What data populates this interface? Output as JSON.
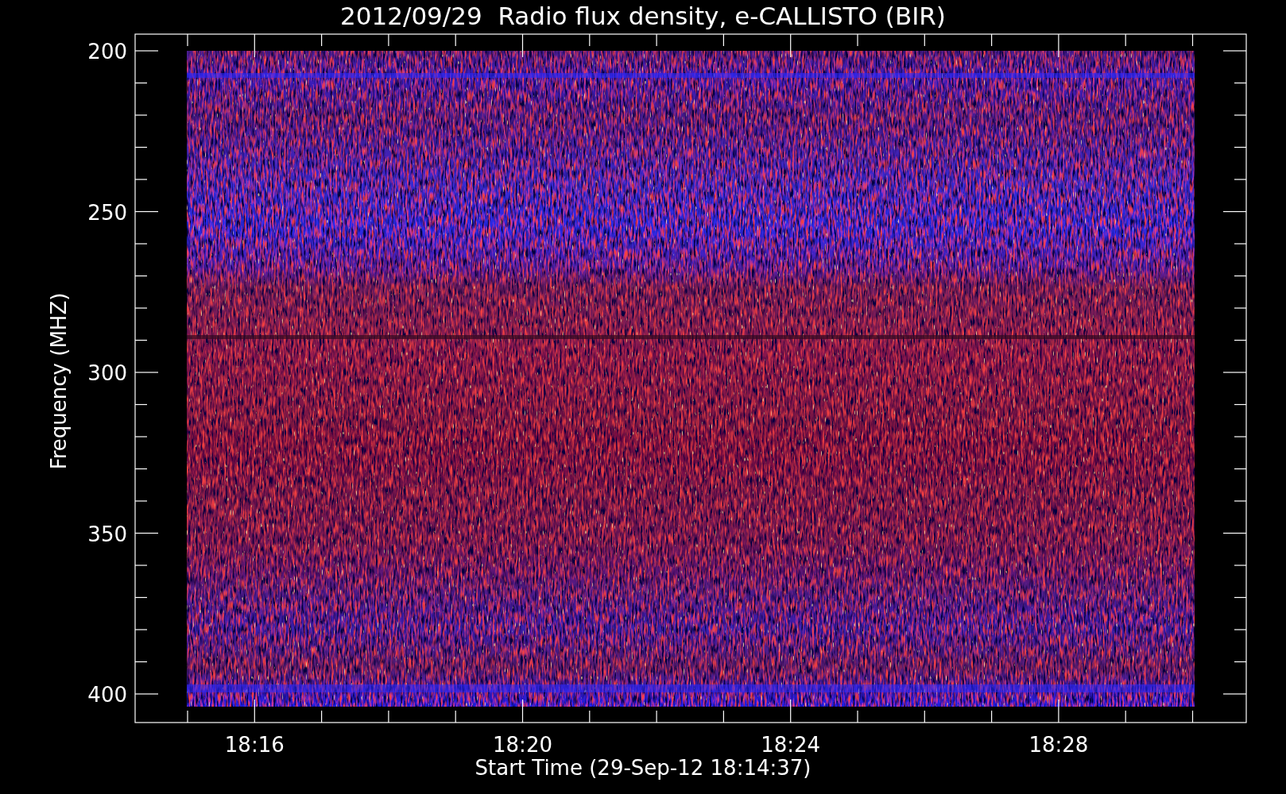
{
  "title": "2012/09/29  Radio flux density, e-CALLISTO (BIR)",
  "y_axis": {
    "title": "Frequency (MHZ)",
    "ticks": [
      "200",
      "250",
      "300",
      "350",
      "400"
    ]
  },
  "x_axis": {
    "title": "Start Time (29-Sep-12 18:14:37)",
    "ticks": [
      "18:16",
      "18:20",
      "18:24",
      "18:28"
    ]
  }
}
